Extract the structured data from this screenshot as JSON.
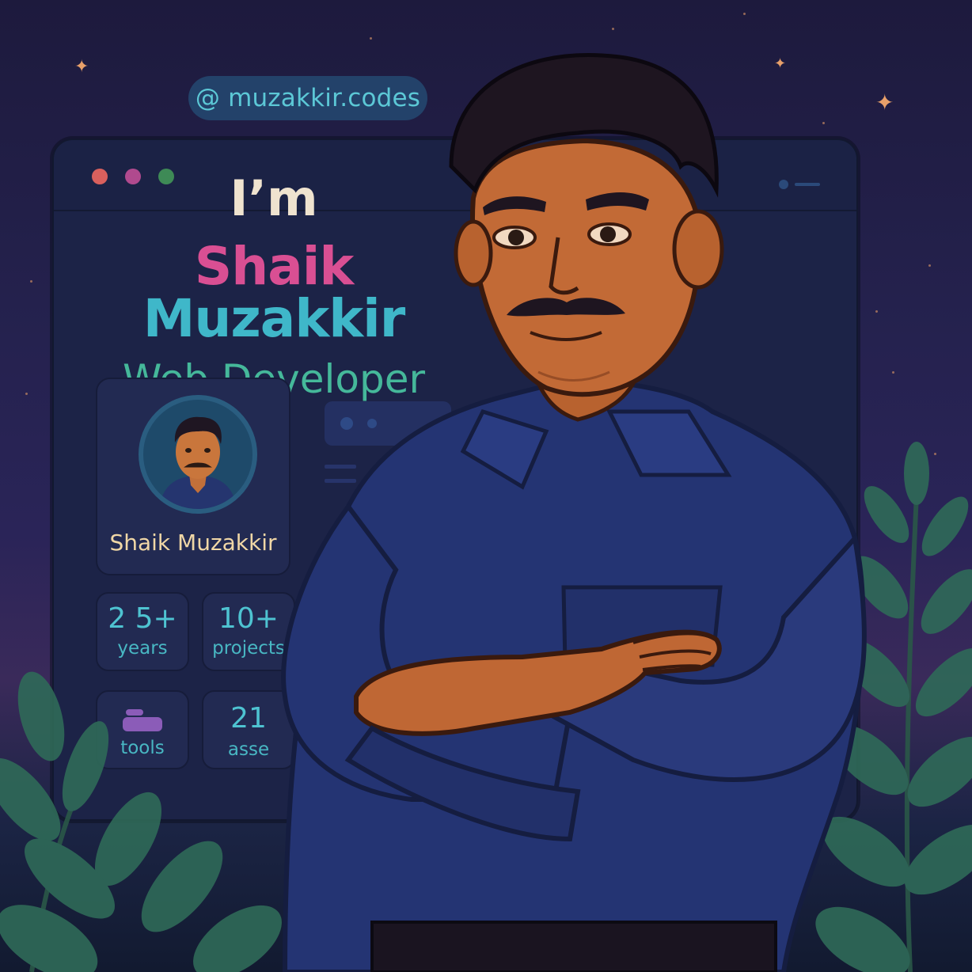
{
  "handle": "@ muzakkir.codes",
  "intro": {
    "greeting": "I’m",
    "first_name": "Shaik",
    "last_name": "Muzakkir",
    "role": "Web Developer"
  },
  "profile_card": {
    "name": "Shaik Muzakkir"
  },
  "stats": [
    {
      "value": "2 5+",
      "label": "years"
    },
    {
      "value": "10+",
      "label": "projects"
    },
    {
      "value": "",
      "label": "tools"
    },
    {
      "value": "21",
      "label": "asse"
    }
  ],
  "icons": {
    "window_close": "red-dot-icon",
    "window_minimize": "pink-dot-icon",
    "window_maximize": "green-dot-icon",
    "tools": "toolbox-icon"
  },
  "colors": {
    "accent_pink": "#d94f93",
    "accent_cyan": "#3fb7c9",
    "accent_green": "#45b89a",
    "background": "#25224f"
  }
}
